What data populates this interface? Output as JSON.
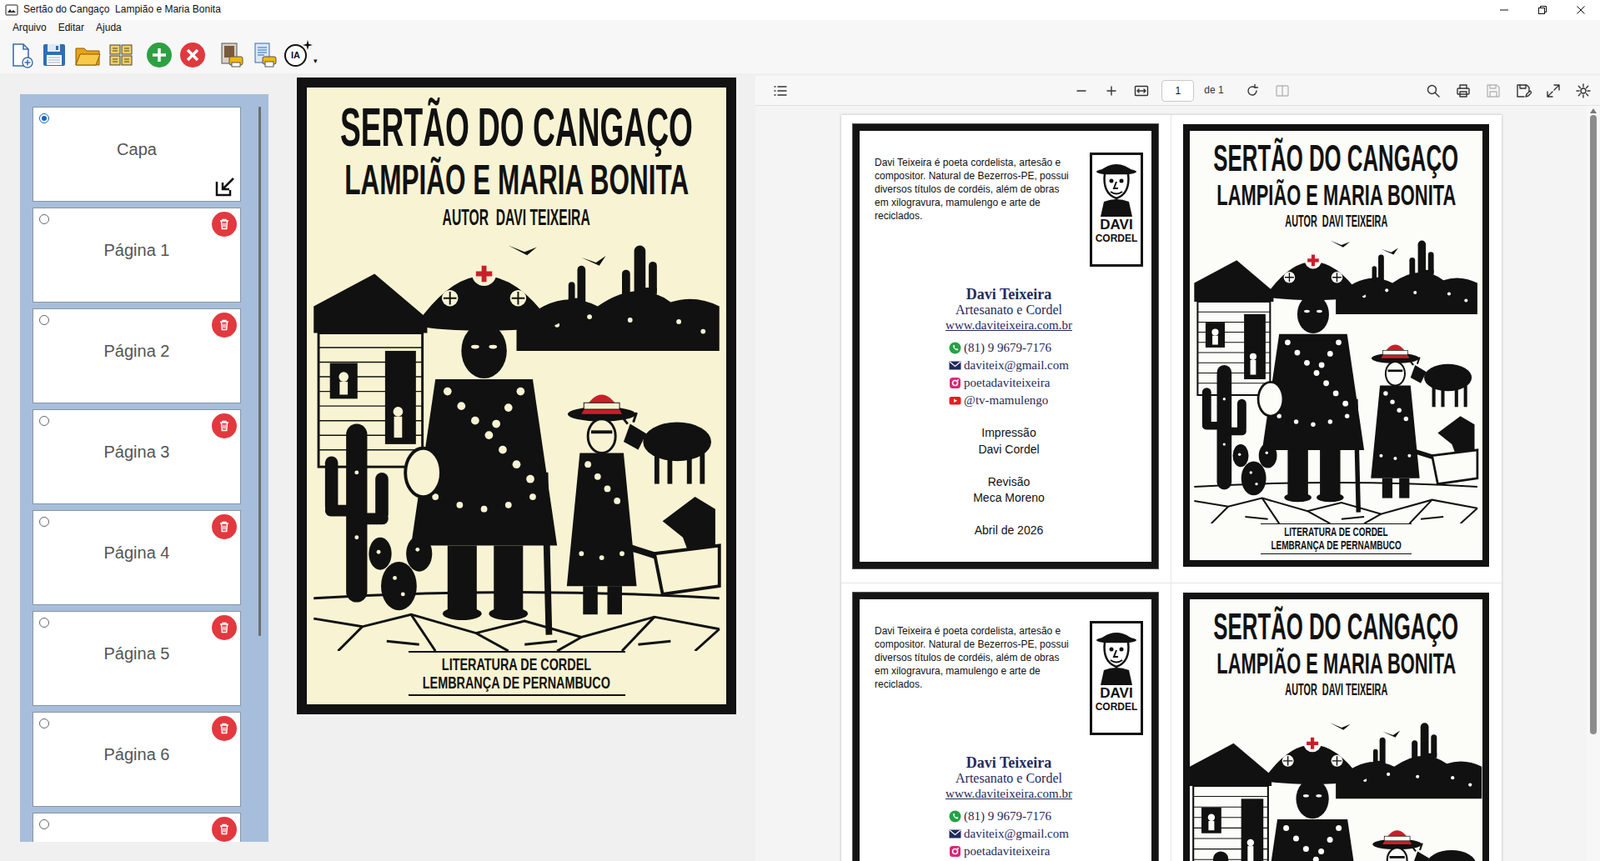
{
  "window": {
    "title": "Sertão do Cangaço  Lampião e Maria Bonita"
  },
  "menu": [
    "Arquivo",
    "Editar",
    "Ajuda"
  ],
  "toolbar": [
    {
      "kind": "new"
    },
    {
      "kind": "save"
    },
    {
      "kind": "open"
    },
    {
      "kind": "layout"
    },
    {
      "kind": "add"
    },
    {
      "kind": "remove"
    },
    {
      "kind": "print-cover"
    },
    {
      "kind": "print-pages"
    },
    {
      "kind": "ai",
      "label": "IA",
      "arrow": "▾"
    }
  ],
  "sidebar": {
    "items": [
      {
        "label": "Capa",
        "kind": "cover",
        "selected": true
      },
      {
        "label": "Página 1",
        "kind": "page",
        "selected": false
      },
      {
        "label": "Página 2",
        "kind": "page",
        "selected": false
      },
      {
        "label": "Página 3",
        "kind": "page",
        "selected": false
      },
      {
        "label": "Página 4",
        "kind": "page",
        "selected": false
      },
      {
        "label": "Página 5",
        "kind": "page",
        "selected": false
      },
      {
        "label": "Página 6",
        "kind": "page",
        "selected": false
      },
      {
        "kind": "page",
        "selected": false
      }
    ],
    "scrollbar": {
      "level": 0.72
    }
  },
  "cover": {
    "title": "SERTÃO DO CANGAÇO",
    "subtitle": "LAMPIÃO E MARIA BONITA",
    "author": "AUTOR  DAVI TEIXEIRA",
    "footer": [
      "LITERATURA DE CORDEL",
      "LEMBRANÇA DE PERNAMBUCO"
    ]
  },
  "viewer": {
    "toolbar": {
      "left": [
        {
          "kind": "outline",
          "disabled": false
        }
      ],
      "zoom": [
        {
          "kind": "zoom-out",
          "disabled": false
        },
        {
          "kind": "zoom-in",
          "disabled": false
        },
        {
          "kind": "fit",
          "disabled": false
        }
      ],
      "page": "1",
      "total": "de 1",
      "page_tools": [
        {
          "kind": "rotate",
          "disabled": false
        },
        {
          "kind": "spread",
          "disabled": true
        }
      ],
      "right": [
        {
          "kind": "search",
          "disabled": false
        },
        {
          "kind": "print",
          "disabled": false
        },
        {
          "kind": "save",
          "disabled": true
        },
        {
          "kind": "save-as",
          "disabled": false
        },
        {
          "kind": "fullscreen",
          "disabled": false
        },
        {
          "kind": "settings",
          "disabled": false
        }
      ]
    },
    "scrollbar": {
      "level": 0.83
    },
    "sheet": [
      {
        "back": {
          "bio": "Davi Teixeira é poeta cordelista, artesão e compositor. Natural de Bezerros-PE, possui diversos títulos de cordéis, além de obras em xilogravura, mamulengo e arte de reciclados.",
          "logo": [
            "DAVI",
            "CORDEL"
          ],
          "name": "Davi Teixeira",
          "tagline": "Artesanato e Cordel",
          "url": "www.daviteixeira.com.br",
          "contacts": [
            {
              "kind": "whatsapp",
              "text": "(81) 9 9679-7176"
            },
            {
              "kind": "email",
              "text": "daviteix@gmail.com"
            },
            {
              "kind": "instagram",
              "text": "poetadaviteixeira"
            },
            {
              "kind": "youtube",
              "text": "@tv-mamulengo"
            }
          ],
          "credits": [
            [
              "Impressão",
              "Davi Cordel"
            ],
            [
              "Revisão",
              "Meca Moreno"
            ],
            [
              "Abril de 2026"
            ]
          ]
        },
        "front": {
          "title": "SERTÃO DO CANGAÇO",
          "subtitle": "LAMPIÃO E MARIA BONITA",
          "author": "AUTOR  DAVI TEIXEIRA",
          "footer": [
            "LITERATURA DE CORDEL",
            "LEMBRANÇA DE PERNAMBUCO"
          ]
        }
      },
      {
        "back": {
          "bio": "Davi Teixeira é poeta cordelista, artesão e compositor. Natural de Bezerros-PE, possui diversos títulos de cordéis, além de obras em xilogravura, mamulengo e arte de reciclados.",
          "logo": [
            "DAVI",
            "CORDEL"
          ],
          "name": "Davi Teixeira",
          "tagline": "Artesanato e Cordel",
          "url": "www.daviteixeira.com.br",
          "contacts": [
            {
              "kind": "whatsapp",
              "text": "(81) 9 9679-7176"
            },
            {
              "kind": "email",
              "text": "daviteix@gmail.com"
            },
            {
              "kind": "instagram",
              "text": "poetadaviteixeira"
            }
          ]
        },
        "front": {
          "title": "SERTÃO DO CANGAÇO",
          "subtitle": "LAMPIÃO E MARIA BONITA",
          "author": "AUTOR  DAVI TEIXEIRA"
        }
      }
    ]
  }
}
